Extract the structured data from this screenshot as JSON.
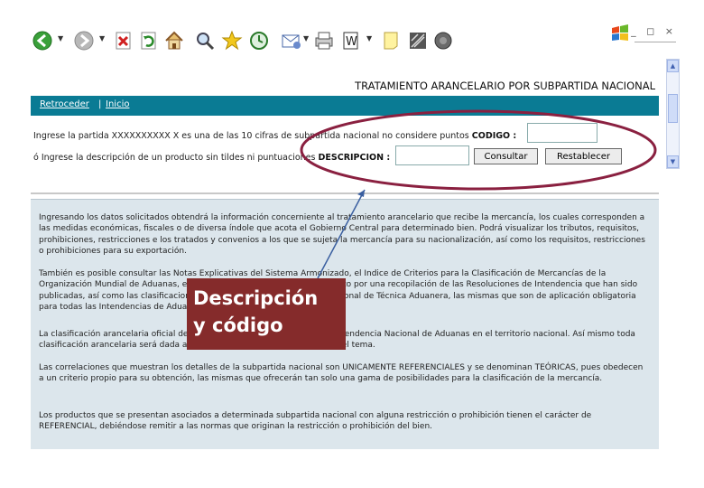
{
  "toolbar": {
    "icons": [
      "back-icon",
      "forward-icon",
      "stop-icon",
      "refresh-icon",
      "home-icon",
      "search-icon",
      "favorites-icon",
      "history-icon",
      "mail-icon",
      "print-icon",
      "edit-icon",
      "discuss-icon",
      "messenger-icon"
    ]
  },
  "window_controls": "_ ◻ ×",
  "header": {
    "title": "TRATAMIENTO ARANCELARIO POR SUBPARTIDA NACIONAL"
  },
  "nav": {
    "back_label": "Retroceder",
    "separator": "|",
    "home_label": "Inicio"
  },
  "form": {
    "code_prompt": "Ingrese la partida XXXXXXXXXX X es una de las 10 cifras de subpartida nacional no considere puntos",
    "code_label": "CODIGO :",
    "code_value": "",
    "desc_prompt": "ó Ingrese la descripción de un producto sin tildes ni puntuaciones",
    "desc_label": "DESCRIPCION :",
    "desc_value": "",
    "consult_button": "Consultar",
    "reset_button": "Restablecer"
  },
  "info": {
    "p1": "Ingresando los datos solicitados obtendrá la información concerniente al tratamiento arancelario que recibe la mercancía, los cuales corresponden a las medidas económicas, fiscales o de diversa índole que acota el Gobierno Central para determinado bien. Podrá visualizar los tributos, requisitos, prohibiciones, restricciones e los tratados y convenios a los que se sujeta la mercancía para su nacionalización, así como los requisitos, restricciones o prohibiciones para su exportación.",
    "p2": "También es posible consultar las Notas Explicativas del Sistema Armonizado, el Indice de Criterios para la Clasificación de Mercancías de la Organización Mundial de Aduanas, el Indice Nacional de Criterios compuesto por una recopilación de las Resoluciones de Intendencia que han sido publicadas, así como las clasificaciones efectuadas por la Intendencia Nacional de Técnica Aduanera, las mismas que son de aplicación obligatoria para todas las Intendencias de Aduana de la República.",
    "p3": "La clasificación arancelaria oficial del producto es la que otorga la Superintendencia Nacional de Aduanas en el territorio nacional. Así mismo toda clasificación arancelaria será dada a conocer por personal especialista en el tema.",
    "p4": "Las correlaciones que muestran los detalles de la subpartida nacional son UNICAMENTE REFERENCIALES y se denominan TEÓRICAS, pues obedecen a un criterio propio para su obtención, las mismas que ofrecerán tan solo una gama de posibilidades para la clasificación de la mercancía.",
    "p5": "Los productos que se presentan asociados a determinada subpartida nacional con alguna restricción o prohibición tienen el carácter de REFERENCIAL, debiéndose remitir a las normas que originan la restricción o prohibición del bien."
  },
  "callout": {
    "line1": "Descripción",
    "line2": "y código"
  },
  "colors": {
    "navbar": "#0a7b94",
    "info_bg": "#dce6ec",
    "callout": "#852b2b",
    "ellipse": "#8a2040",
    "arrow": "#3a5fa0"
  }
}
